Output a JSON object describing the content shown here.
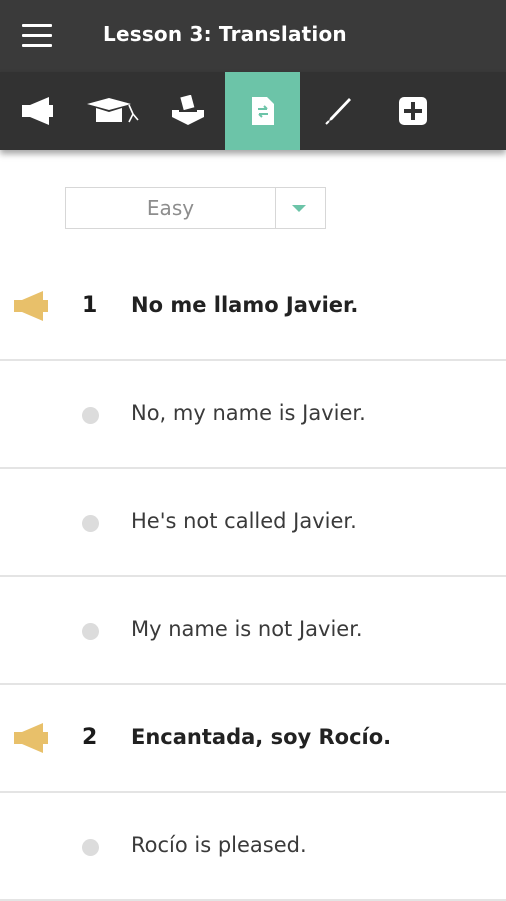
{
  "header": {
    "title": "Lesson 3: Translation"
  },
  "toolbar": {
    "tabs": [
      {
        "icon": "megaphone-icon",
        "active": false
      },
      {
        "icon": "graduation-cap-icon",
        "active": false
      },
      {
        "icon": "ballot-box-icon",
        "active": false
      },
      {
        "icon": "translate-document-icon",
        "active": true
      },
      {
        "icon": "pencil-icon",
        "active": false
      },
      {
        "icon": "plus-icon",
        "active": false
      }
    ],
    "active_color": "#6cc4a8"
  },
  "difficulty": {
    "selected": "Easy"
  },
  "questions": [
    {
      "number": "1",
      "text": "No me llamo Javier.",
      "answers": [
        "No, my name is Javier.",
        "He's not called Javier.",
        "My name is not Javier."
      ]
    },
    {
      "number": "2",
      "text": "Encantada, soy Rocío.",
      "answers": [
        "Rocío is pleased."
      ]
    }
  ],
  "colors": {
    "speaker": "#e8c06a",
    "dot": "#dcdcdc",
    "bar": "#3a3a3a"
  }
}
